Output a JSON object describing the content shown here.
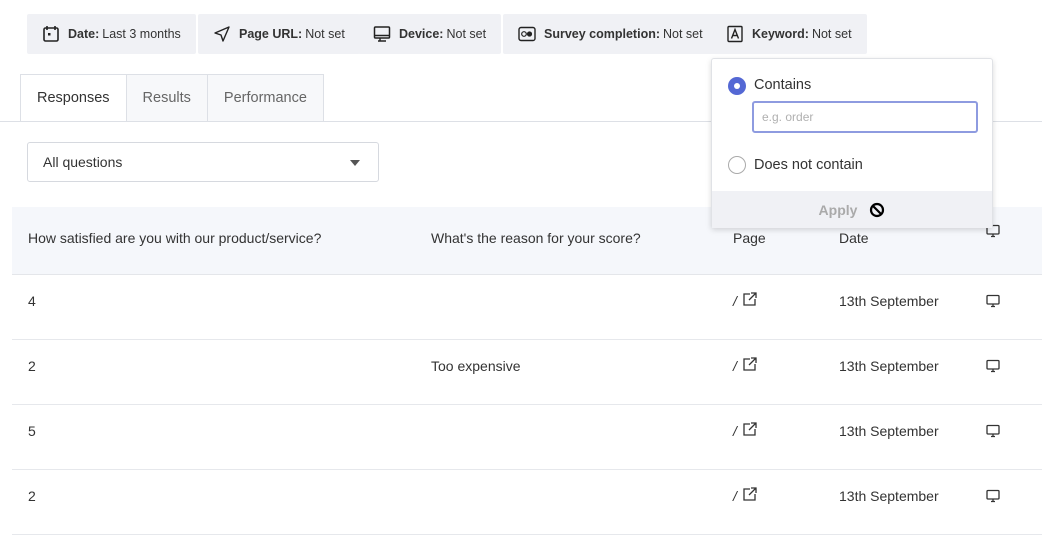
{
  "filters": [
    {
      "label": "Date:",
      "value": "Last 3 months",
      "icon": "calendar-icon"
    },
    {
      "label": "Page URL:",
      "value": "Not set",
      "icon": "navigation-arrow-icon"
    },
    {
      "label": "Device:",
      "value": "Not set",
      "icon": "monitor-icon"
    },
    {
      "label": "Survey completion:",
      "value": "Not set",
      "icon": "toggle-icon"
    },
    {
      "label": "Keyword:",
      "value": "Not set",
      "icon": "letter-a-icon"
    }
  ],
  "tabs": [
    {
      "label": "Responses",
      "active": true
    },
    {
      "label": "Results"
    },
    {
      "label": "Performance"
    }
  ],
  "question_select": {
    "value": "All questions"
  },
  "table": {
    "headers": [
      "How satisfied are you with our product/service?",
      "What's the reason for your score?",
      "Page",
      "Date",
      ""
    ],
    "rows": [
      {
        "score": "4",
        "reason": "",
        "page": "/",
        "date": "13th September",
        "device": "desktop"
      },
      {
        "score": "2",
        "reason": "Too expensive",
        "page": "/",
        "date": "13th September",
        "device": "desktop"
      },
      {
        "score": "5",
        "reason": "",
        "page": "/",
        "date": "13th September",
        "device": "desktop"
      },
      {
        "score": "2",
        "reason": "",
        "page": "/",
        "date": "13th September",
        "device": "desktop"
      }
    ]
  },
  "keyword_popup": {
    "options": [
      {
        "label": "Contains",
        "selected": true
      },
      {
        "label": "Does not contain",
        "selected": false
      }
    ],
    "placeholder": "e.g. order",
    "apply_label": "Apply",
    "accent": "#5468d4"
  }
}
